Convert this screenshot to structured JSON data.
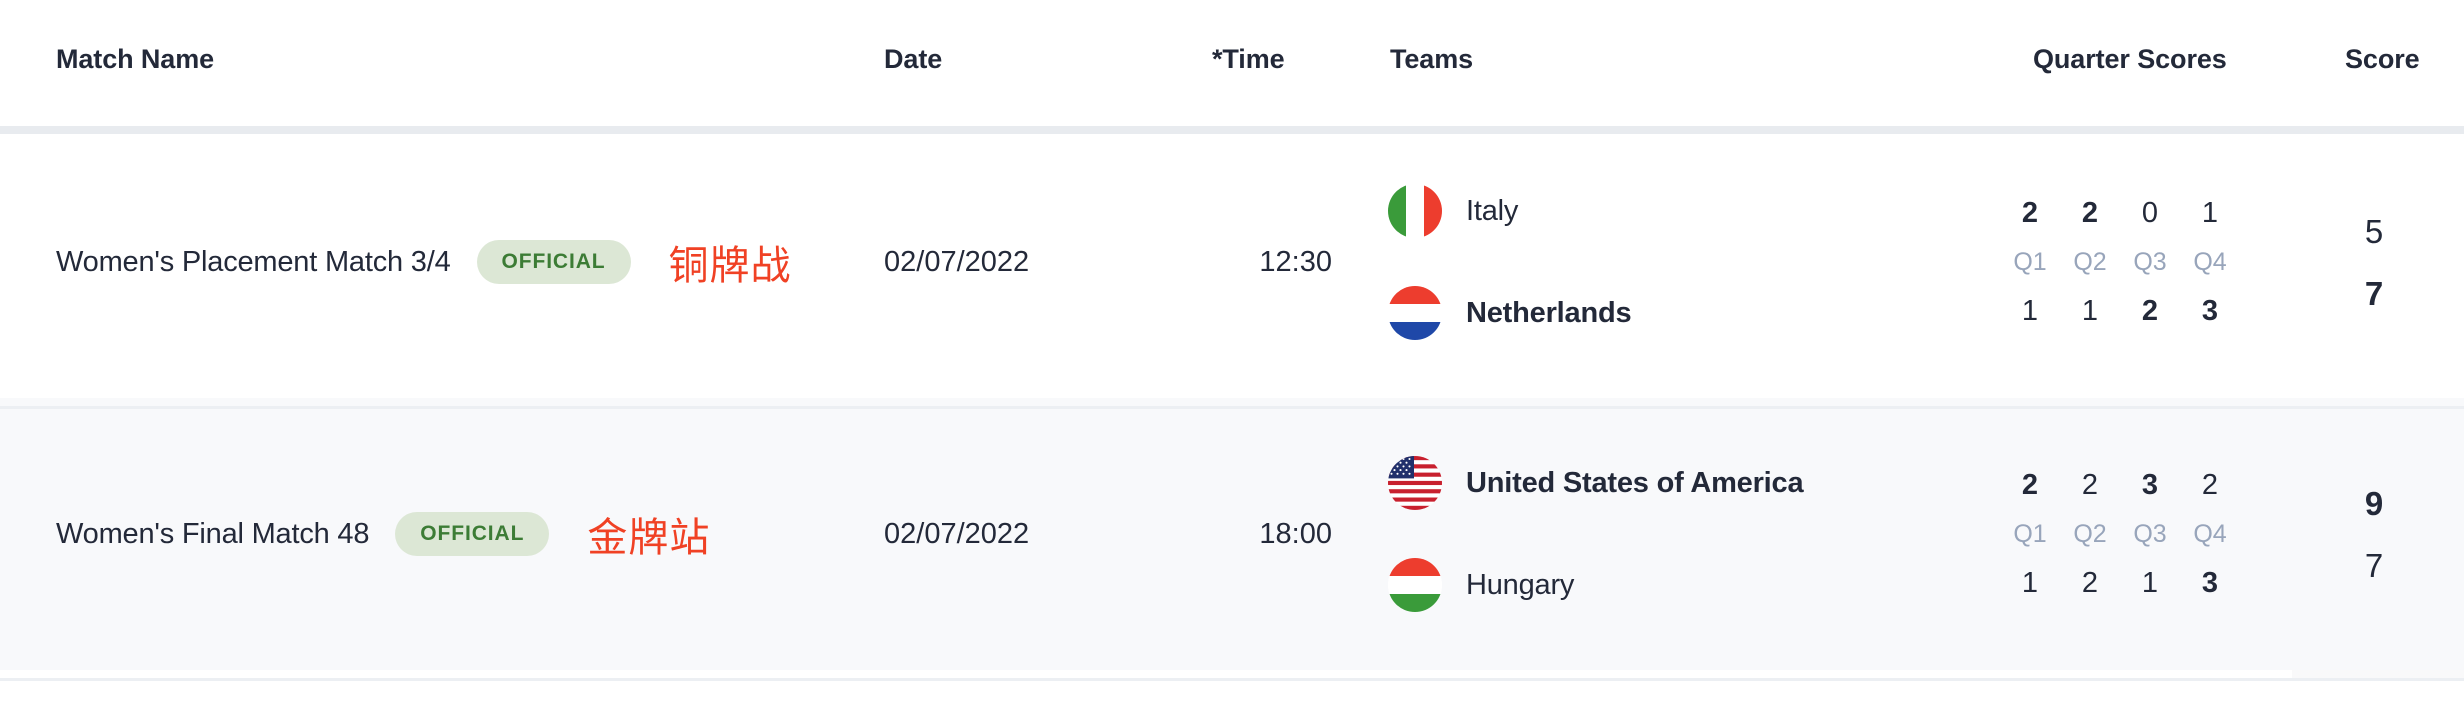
{
  "table": {
    "columns": {
      "match_name": "Match Name",
      "date": "Date",
      "time": "*Time",
      "teams": "Teams",
      "quarter_scores": "Quarter Scores",
      "score": "Score"
    },
    "colors": {
      "text": "#232939",
      "badge_bg": "#dce7d5",
      "badge_text": "#3c7c35",
      "annotation_red": "#f04124",
      "quarter_label": "#98a5bb",
      "row_alt_bg": "#f8f9fb",
      "score_col_bg": "#f9f9fa",
      "divider": "#eceff3",
      "head_divider": "#e8ebef"
    },
    "rows": [
      {
        "match_name": "Women's Placement Match 3/4",
        "badge": "OFFICIAL",
        "annotation": "铜牌战",
        "date": "02/07/2022",
        "time": "12:30",
        "quarter_labels": [
          "Q1",
          "Q2",
          "Q3",
          "Q4"
        ],
        "teams": [
          {
            "name": "Italy",
            "flag": "flag-italy-icon",
            "winner": false,
            "quarters": [
              "2",
              "2",
              "0",
              "1"
            ],
            "quarters_high": [
              true,
              true,
              false,
              false
            ],
            "score": "5"
          },
          {
            "name": "Netherlands",
            "flag": "flag-netherlands-icon",
            "winner": true,
            "quarters": [
              "1",
              "1",
              "2",
              "3"
            ],
            "quarters_high": [
              false,
              false,
              true,
              true
            ],
            "score": "7"
          }
        ]
      },
      {
        "match_name": "Women's Final Match 48",
        "badge": "OFFICIAL",
        "annotation": "金牌站",
        "date": "02/07/2022",
        "time": "18:00",
        "quarter_labels": [
          "Q1",
          "Q2",
          "Q3",
          "Q4"
        ],
        "teams": [
          {
            "name": "United States of America",
            "flag": "flag-usa-icon",
            "winner": true,
            "quarters": [
              "2",
              "2",
              "3",
              "2"
            ],
            "quarters_high": [
              true,
              false,
              true,
              false
            ],
            "score": "9"
          },
          {
            "name": "Hungary",
            "flag": "flag-hungary-icon",
            "winner": false,
            "quarters": [
              "1",
              "2",
              "1",
              "3"
            ],
            "quarters_high": [
              false,
              false,
              false,
              true
            ],
            "score": "7"
          }
        ]
      }
    ]
  }
}
